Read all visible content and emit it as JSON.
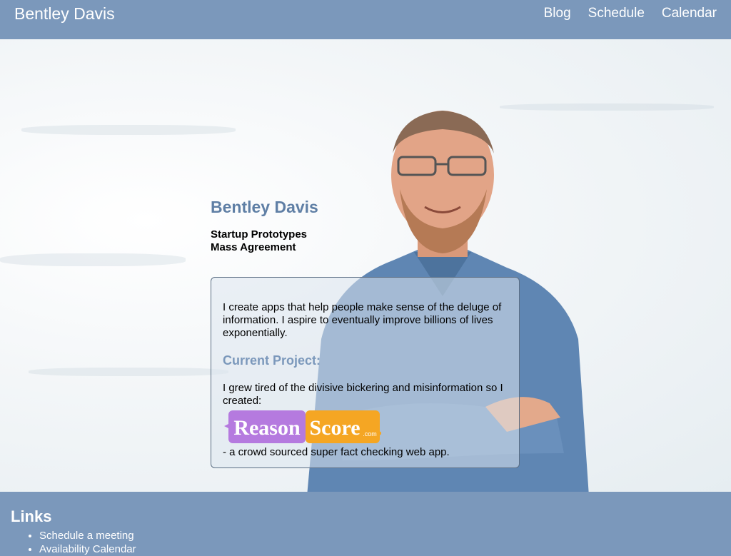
{
  "header": {
    "brand": "Bentley Davis",
    "nav": [
      "Blog",
      "Schedule",
      "Calendar"
    ]
  },
  "hero": {
    "name": "Bentley Davis",
    "subtitle_lines": [
      "Startup Prototypes",
      "Mass Agreement"
    ],
    "intro": "I create apps that help people make sense of the deluge of information. I aspire to eventually improve billions of lives exponentially.",
    "project_heading": "Current Project:",
    "project_text": "I grew tired of the divisive bickering and misinformation so I created:",
    "logo": {
      "word1": "Reason",
      "word2": "Score",
      "suffix": ".com"
    },
    "project_tail": "- a crowd sourced super fact checking web app."
  },
  "footer": {
    "title": "Links",
    "links": [
      "Schedule a meeting",
      "Availability Calendar"
    ]
  },
  "colors": {
    "navbar": "#7b98bb",
    "name": "#5f7fa5",
    "logo_purple": "#b57adf",
    "logo_orange": "#f5a623",
    "shirt": "#5f86b3"
  }
}
